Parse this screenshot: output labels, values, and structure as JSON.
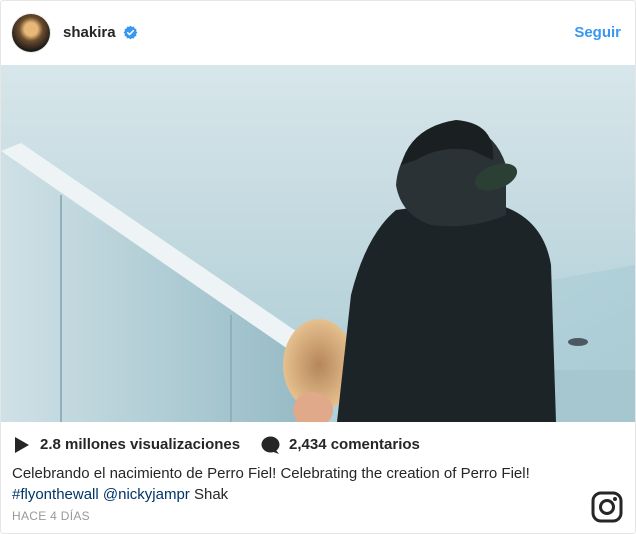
{
  "header": {
    "username": "shakira",
    "follow_label": "Seguir"
  },
  "stats": {
    "views": "2.8 millones visualizaciones",
    "comments": "2,434 comentarios"
  },
  "caption": {
    "text": "Celebrando el nacimiento de Perro Fiel! Celebrating the creation of Perro Fiel!",
    "hashtag": "#flyonthewall",
    "mention": "@nickyjampr",
    "suffix": "Shak"
  },
  "timestamp": "HACE 4 DÍAS",
  "icons": {
    "verified": "verified-badge-icon",
    "play": "play-icon",
    "comment": "comment-bubble-icon",
    "logo": "instagram-logo-icon"
  },
  "colors": {
    "accent": "#3897f0",
    "link": "#003569",
    "muted": "#999999",
    "text": "#262626"
  }
}
